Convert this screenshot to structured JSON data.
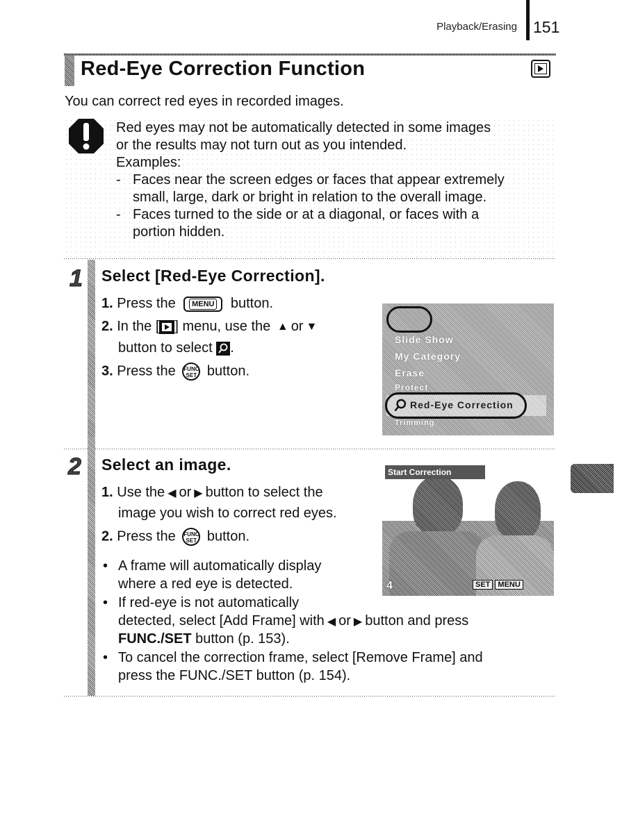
{
  "header": {
    "section": "Playback/Erasing",
    "page_number": "151"
  },
  "title": {
    "text": "Red-Eye Correction Function",
    "mode_icon": "playback-icon"
  },
  "intro": "You can correct red eyes in recorded images.",
  "caution": {
    "icon": "caution-icon",
    "lines": [
      "Red eyes may not be automatically detected in some images",
      "or the results may not turn out as you intended.",
      "Examples:"
    ],
    "examples": [
      {
        "dash": "-",
        "lines": [
          "Faces near the screen edges or faces that appear extremely",
          "small, large, dark or bright in relation to the overall image."
        ]
      },
      {
        "dash": "-",
        "lines": [
          "Faces turned to the side or at a diagonal, or faces with a",
          "portion hidden."
        ]
      }
    ]
  },
  "steps": [
    {
      "number": "1",
      "title": "Select [Red-Eye Correction].",
      "instructions": {
        "s1_num": "1.",
        "s1_pre": "Press the",
        "s1_btn": "MENU",
        "s1_post": "button.",
        "s2_num": "2.",
        "s2_pre": "In the [",
        "s2_mid": "] menu, use the",
        "s2_or": "or",
        "s2_line2_pre": "button to select",
        "s2_line2_post": ".",
        "s3_num": "3.",
        "s3_pre": "Press the",
        "s3_btn_top": "FUNC",
        "s3_btn_bottom": "SET",
        "s3_post": "button."
      },
      "screen": {
        "menu_items": [
          "Slide Show",
          "My Category",
          "Erase",
          "Protect",
          "Red-Eye Correction",
          "Trimming"
        ],
        "selected": "Red-Eye Correction"
      }
    },
    {
      "number": "2",
      "title": "Select an image.",
      "instructions": {
        "s1_num": "1.",
        "s1_pre": "Use the",
        "s1_or": "or",
        "s1_post": "button to select the",
        "s1_line2": "image you wish to correct red eyes.",
        "s2_num": "2.",
        "s2_pre": "Press the",
        "s2_btn_top": "FUNC",
        "s2_btn_bottom": "SET",
        "s2_post": "button."
      },
      "bullets": {
        "b1_line1": "A frame will automatically display",
        "b1_line2": "where a red eye is detected.",
        "b2_line1": "If red-eye is not automatically",
        "b2_line2_pre": "detected, select [Add Frame] with",
        "b2_line2_or": "or",
        "b2_line2_post": "button and press",
        "b2_line3_bold": "FUNC./SET",
        "b2_line3_rest": " button (p. 153).",
        "b3_line1": "To cancel the correction frame, select [Remove Frame] and",
        "b3_line2": "press the FUNC./SET button (p. 154)."
      },
      "screen": {
        "top_label": "Start Correction",
        "bottom_left": "4",
        "bottom_right_set": "SET",
        "bottom_right_menu": "MENU"
      }
    }
  ],
  "bullet_glyph": "•",
  "arrows": {
    "up": "▲",
    "down": "▼",
    "left": "◀",
    "right": "▶"
  }
}
